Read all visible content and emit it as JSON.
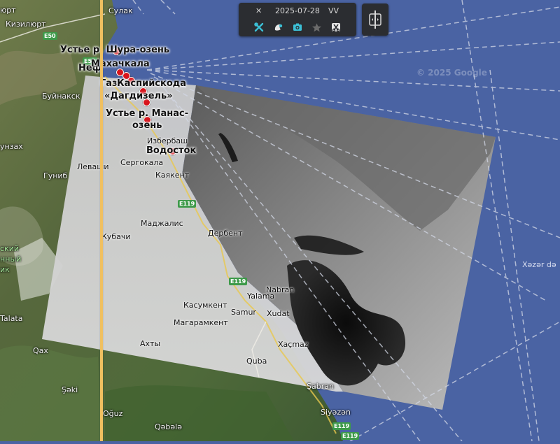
{
  "map": {
    "watermark": "© 2025 Google",
    "marker_labels": [
      {
        "id": "shura",
        "text": "Устье р. Шура-озень"
      },
      {
        "id": "neft",
        "text": "Неф"
      },
      {
        "id": "mkh",
        "text": "Махачкала"
      },
      {
        "id": "gas",
        "text": "Газ"
      },
      {
        "id": "kasp",
        "text": "Каспийскода"
      },
      {
        "id": "dag1",
        "text": "«Дагдизель»"
      },
      {
        "id": "man1",
        "text": "Устье р. Манас-"
      },
      {
        "id": "man2",
        "text": "озень"
      },
      {
        "id": "vod",
        "text": "Водосток"
      }
    ],
    "places": [
      {
        "id": "sulak",
        "text": "Сулак"
      },
      {
        "id": "kizilyurt",
        "text": "Кизилюрт"
      },
      {
        "id": "buynaksk",
        "text": "Буйнакск"
      },
      {
        "id": "unzakh",
        "text": "унзах"
      },
      {
        "id": "gunib",
        "text": "Гуниб"
      },
      {
        "id": "levashi",
        "text": "Леваши"
      },
      {
        "id": "sergokala",
        "text": "Сергокала"
      },
      {
        "id": "izberbash",
        "text": "Избербаш"
      },
      {
        "id": "kayakent",
        "text": "Каякент"
      },
      {
        "id": "madzhalis",
        "text": "Маджалис"
      },
      {
        "id": "derbent",
        "text": "Дербент"
      },
      {
        "id": "kubachi",
        "text": "Кубачи"
      },
      {
        "id": "nabran",
        "text": "Nabran"
      },
      {
        "id": "yalama",
        "text": "Yalama"
      },
      {
        "id": "kasumkent",
        "text": "Касумкент"
      },
      {
        "id": "samur",
        "text": "Samur"
      },
      {
        "id": "xudat",
        "text": "Xudat"
      },
      {
        "id": "magaramkent",
        "text": "Магарамкент"
      },
      {
        "id": "akhty",
        "text": "Ахты"
      },
      {
        "id": "xacmaz",
        "text": "Xaçmaz"
      },
      {
        "id": "quba",
        "text": "Quba"
      },
      {
        "id": "sabran",
        "text": "Şabran"
      },
      {
        "id": "qax",
        "text": "Qax"
      },
      {
        "id": "seki",
        "text": "Şəki"
      },
      {
        "id": "oguz",
        "text": "Oğuz"
      },
      {
        "id": "qabala",
        "text": "Qəbələ"
      },
      {
        "id": "siyezen",
        "text": "Siyəzən"
      },
      {
        "id": "talata",
        "text": "Talata"
      },
      {
        "id": "urt",
        "text": "юрт"
      },
      {
        "id": "ski",
        "text": "ский"
      },
      {
        "id": "ny",
        "text": "нный"
      },
      {
        "id": "ik",
        "text": "ик"
      },
      {
        "id": "xazar",
        "text": "Xəzər də"
      }
    ],
    "highways": [
      {
        "id": "e50a",
        "text": "E50"
      },
      {
        "id": "e50b",
        "text": "E50"
      },
      {
        "id": "e119a",
        "text": "E119"
      },
      {
        "id": "e119b",
        "text": "E119"
      },
      {
        "id": "e119c",
        "text": "E119"
      },
      {
        "id": "e119d",
        "text": "E119"
      }
    ]
  },
  "toolbar": {
    "date": "2025-07-28",
    "polarization": "VV",
    "accent_color": "#3cc0d6",
    "icons": [
      "tools-icon",
      "layers-icon",
      "camera-icon",
      "star-icon",
      "scissors-icon"
    ]
  },
  "compare": {
    "icon": "split-compare-icon"
  },
  "divider": {
    "color": "#f0c060"
  }
}
